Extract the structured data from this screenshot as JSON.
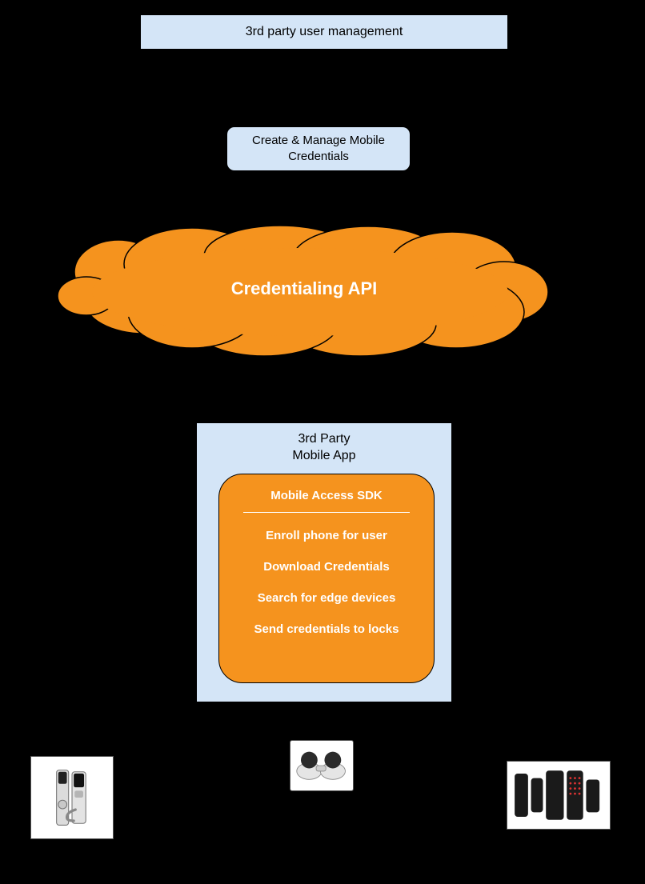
{
  "top_box": {
    "label": "3rd party user management"
  },
  "mid_box": {
    "label": "Create & Manage Mobile\nCredentials"
  },
  "cloud": {
    "label": "Credentialing API"
  },
  "app": {
    "title": "3rd Party\nMobile App",
    "sdk": {
      "title": "Mobile Access SDK",
      "items": [
        "Enroll phone for user",
        "Download Credentials",
        "Search for edge devices",
        "Send credentials to locks"
      ]
    }
  },
  "devices": {
    "left": "lock-hardware-image",
    "mid": "edge-device-image",
    "right": "reader-devices-image"
  }
}
